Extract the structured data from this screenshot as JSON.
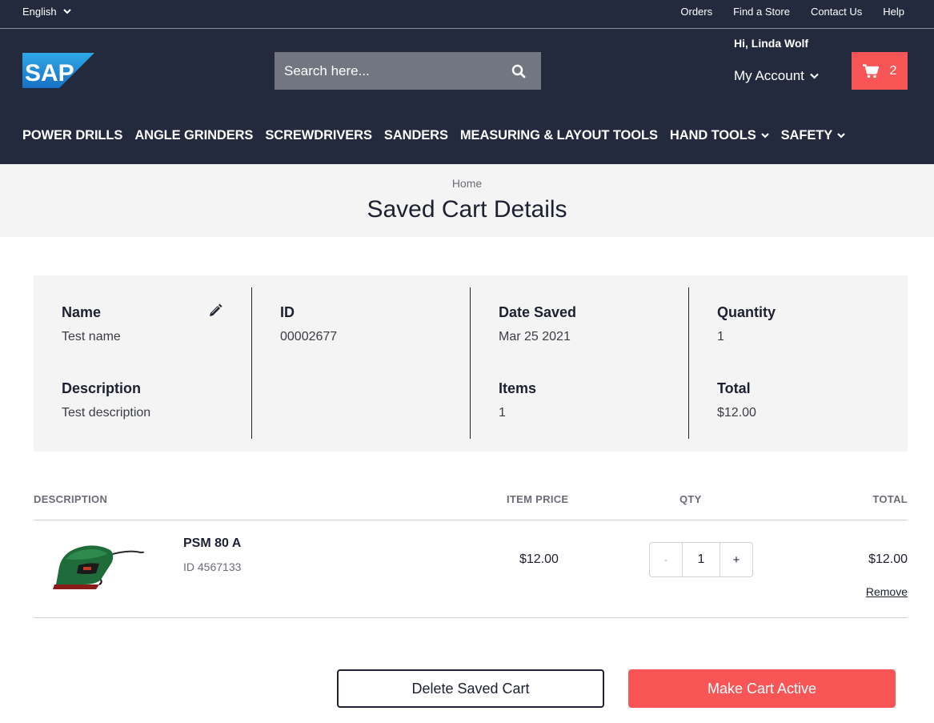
{
  "topbar": {
    "language": "English",
    "links": [
      "Orders",
      "Find a Store",
      "Contact Us",
      "Help"
    ]
  },
  "header": {
    "logo_text": "SAP",
    "search_placeholder": "Search here...",
    "greeting": "Hi, Linda Wolf",
    "account_label": "My Account",
    "cart_count": "2",
    "brand_color": "#f85556",
    "header_bg": "#232a3e"
  },
  "nav": {
    "items": [
      {
        "label": "POWER DRILLS",
        "dropdown": false
      },
      {
        "label": "ANGLE GRINDERS",
        "dropdown": false
      },
      {
        "label": "SCREWDRIVERS",
        "dropdown": false
      },
      {
        "label": "SANDERS",
        "dropdown": false
      },
      {
        "label": "MEASURING & LAYOUT TOOLS",
        "dropdown": false
      },
      {
        "label": "HAND TOOLS",
        "dropdown": true
      },
      {
        "label": "SAFETY",
        "dropdown": true
      }
    ]
  },
  "page": {
    "breadcrumb": "Home",
    "title": "Saved Cart Details"
  },
  "summary": {
    "name_label": "Name",
    "name_value": "Test name",
    "description_label": "Description",
    "description_value": "Test description",
    "id_label": "ID",
    "id_value": "00002677",
    "date_label": "Date Saved",
    "date_value": "Mar 25 2021",
    "items_label": "Items",
    "items_value": "1",
    "quantity_label": "Quantity",
    "quantity_value": "1",
    "total_label": "Total",
    "total_value": "$12.00"
  },
  "table": {
    "headers": {
      "description": "DESCRIPTION",
      "item_price": "ITEM PRICE",
      "qty": "QTY",
      "total": "TOTAL"
    },
    "rows": [
      {
        "name": "PSM 80 A",
        "id": "ID 4567133",
        "price": "$12.00",
        "minus": "-",
        "qty": "1",
        "plus": "+",
        "total": "$12.00",
        "remove": "Remove"
      }
    ]
  },
  "actions": {
    "delete_label": "Delete Saved Cart",
    "make_active_label": "Make Cart Active"
  }
}
